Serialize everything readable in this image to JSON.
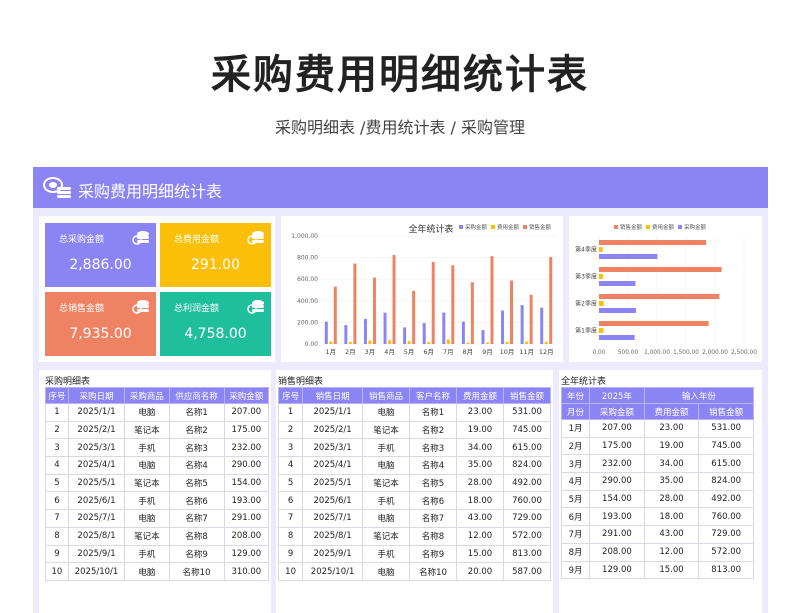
{
  "title": "采购费用明细统计表",
  "subtitle": "采购明细表 /费用统计表 / 采购管理",
  "panel_title": "采购费用明细统计表",
  "stats": [
    {
      "label": "总采购金额",
      "value": "2,886.00",
      "color": "#8a84f5"
    },
    {
      "label": "总费用金额",
      "value": "291.00",
      "color": "#fbbf08"
    },
    {
      "label": "总销售金额",
      "value": "7,935.00",
      "color": "#ef8262"
    },
    {
      "label": "总利润金额",
      "value": "4,758.00",
      "color": "#1fbf9e"
    }
  ],
  "colors": {
    "purchase": "#8a84f5",
    "fee": "#fbbf08",
    "sales": "#ef8262"
  },
  "chart_data": [
    {
      "type": "bar",
      "title": "全年统计表",
      "categories": [
        "1月",
        "2月",
        "3月",
        "4月",
        "5月",
        "6月",
        "7月",
        "8月",
        "9月",
        "10月",
        "11月",
        "12月"
      ],
      "series": [
        {
          "name": "采购金额",
          "values": [
            207,
            175,
            232,
            290,
            154,
            193,
            291,
            208,
            129,
            310,
            360,
            337
          ]
        },
        {
          "name": "费用金额",
          "values": [
            23,
            19,
            34,
            35,
            28,
            18,
            43,
            12,
            15,
            20,
            22,
            22
          ]
        },
        {
          "name": "销售金额",
          "values": [
            531,
            745,
            615,
            824,
            492,
            760,
            729,
            572,
            813,
            587,
            455,
            805
          ]
        }
      ],
      "yticks": [
        "0.00",
        "200.00",
        "400.00",
        "600.00",
        "800.00",
        "1,000.00"
      ],
      "ylim": [
        0,
        1000
      ],
      "legend": "top-right"
    },
    {
      "type": "bar",
      "orientation": "horizontal",
      "categories": [
        "第1季度",
        "第2季度",
        "第3季度",
        "第4季度"
      ],
      "series": [
        {
          "name": "销售金额",
          "values": [
            1891,
            2076,
            2114,
            1847
          ]
        },
        {
          "name": "费用金额",
          "values": [
            76,
            81,
            70,
            64
          ]
        },
        {
          "name": "采购金额",
          "values": [
            614,
            637,
            628,
            1007
          ]
        }
      ],
      "xticks": [
        "0.00",
        "500.00",
        "1,000.00",
        "1,500.00",
        "2,000.00",
        "2,500.00"
      ],
      "xlim": [
        0,
        2500
      ],
      "legend": "top"
    }
  ],
  "purchase_table": {
    "title": "采购明细表",
    "headers": [
      "序号",
      "采购日期",
      "采购商品",
      "供应商名称",
      "采购金额"
    ],
    "rows": [
      [
        "1",
        "2025/1/1",
        "电脑",
        "名称1",
        "207.00"
      ],
      [
        "2",
        "2025/2/1",
        "笔记本",
        "名称2",
        "175.00"
      ],
      [
        "3",
        "2025/3/1",
        "手机",
        "名称3",
        "232.00"
      ],
      [
        "4",
        "2025/4/1",
        "电脑",
        "名称4",
        "290.00"
      ],
      [
        "5",
        "2025/5/1",
        "笔记本",
        "名称5",
        "154.00"
      ],
      [
        "6",
        "2025/6/1",
        "手机",
        "名称6",
        "193.00"
      ],
      [
        "7",
        "2025/7/1",
        "电脑",
        "名称7",
        "291.00"
      ],
      [
        "8",
        "2025/8/1",
        "笔记本",
        "名称8",
        "208.00"
      ],
      [
        "9",
        "2025/9/1",
        "手机",
        "名称9",
        "129.00"
      ],
      [
        "10",
        "2025/10/1",
        "电脑",
        "名称10",
        "310.00"
      ]
    ]
  },
  "sales_table": {
    "title": "销售明细表",
    "headers": [
      "序号",
      "销售日期",
      "销售商品",
      "客户名称",
      "费用金额",
      "销售金额"
    ],
    "rows": [
      [
        "1",
        "2025/1/1",
        "电脑",
        "名称1",
        "23.00",
        "531.00"
      ],
      [
        "2",
        "2025/2/1",
        "笔记本",
        "名称2",
        "19.00",
        "745.00"
      ],
      [
        "3",
        "2025/3/1",
        "手机",
        "名称3",
        "34.00",
        "615.00"
      ],
      [
        "4",
        "2025/4/1",
        "电脑",
        "名称4",
        "35.00",
        "824.00"
      ],
      [
        "5",
        "2025/5/1",
        "笔记本",
        "名称5",
        "28.00",
        "492.00"
      ],
      [
        "6",
        "2025/6/1",
        "手机",
        "名称6",
        "18.00",
        "760.00"
      ],
      [
        "7",
        "2025/7/1",
        "电脑",
        "名称7",
        "43.00",
        "729.00"
      ],
      [
        "8",
        "2025/8/1",
        "笔记本",
        "名称8",
        "12.00",
        "572.00"
      ],
      [
        "9",
        "2025/9/1",
        "手机",
        "名称9",
        "15.00",
        "813.00"
      ],
      [
        "10",
        "2025/10/1",
        "电脑",
        "名称10",
        "20.00",
        "587.00"
      ]
    ]
  },
  "year_table": {
    "title": "全年统计表",
    "year_label": "年份",
    "year_value": "2025年",
    "year_hint": "输入年份",
    "headers": [
      "月份",
      "采购金额",
      "费用金额",
      "销售金额"
    ],
    "rows": [
      [
        "1月",
        "207.00",
        "23.00",
        "531.00"
      ],
      [
        "2月",
        "175.00",
        "19.00",
        "745.00"
      ],
      [
        "3月",
        "232.00",
        "34.00",
        "615.00"
      ],
      [
        "4月",
        "290.00",
        "35.00",
        "824.00"
      ],
      [
        "5月",
        "154.00",
        "28.00",
        "492.00"
      ],
      [
        "6月",
        "193.00",
        "18.00",
        "760.00"
      ],
      [
        "7月",
        "291.00",
        "43.00",
        "729.00"
      ],
      [
        "8月",
        "208.00",
        "12.00",
        "572.00"
      ],
      [
        "9月",
        "129.00",
        "15.00",
        "813.00"
      ]
    ]
  }
}
